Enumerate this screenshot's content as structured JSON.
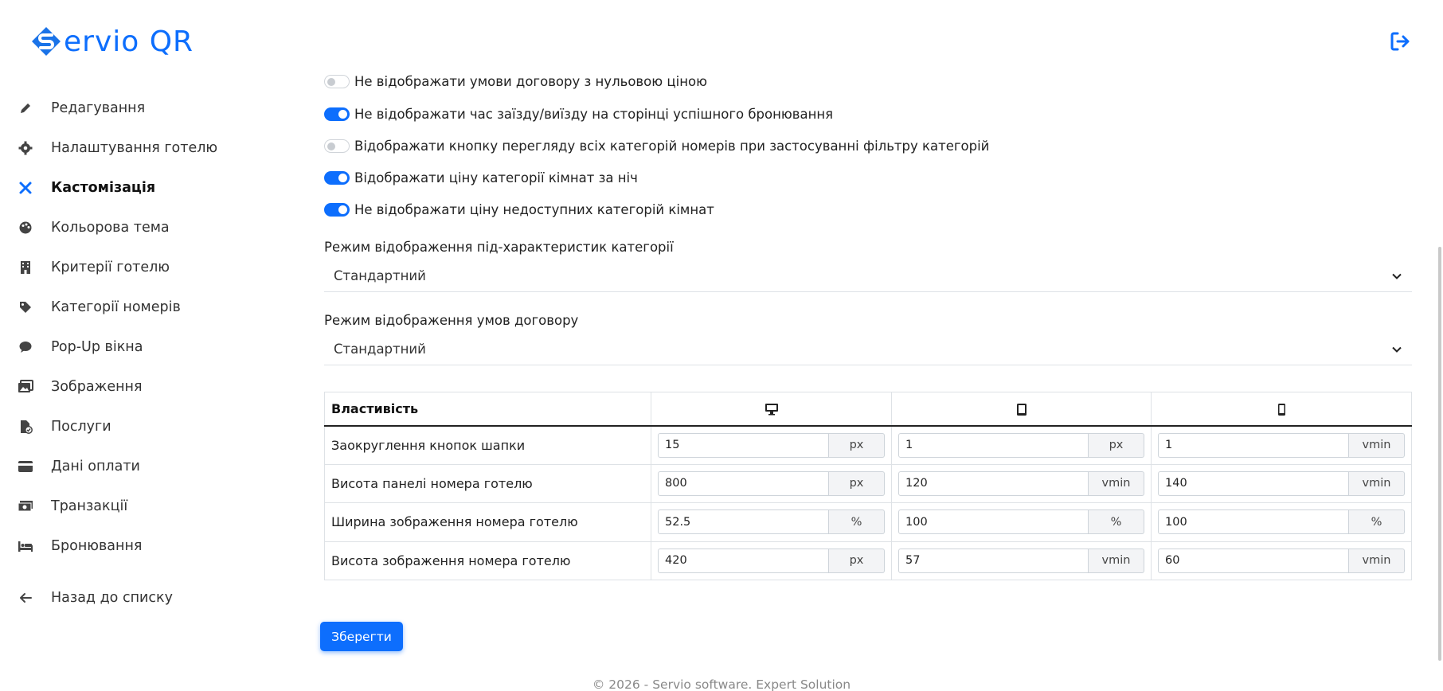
{
  "brand": {
    "logo_text": "ervio QR",
    "logo_icon": "servio-s-logo-icon",
    "accent": "#0d6efd"
  },
  "header": {
    "logout_icon": "logout-icon"
  },
  "sidebar": {
    "items": [
      {
        "label": "Редагування",
        "icon": "pencil-icon"
      },
      {
        "label": "Налаштування готелю",
        "icon": "gear-icon"
      },
      {
        "label": "Кастомізація",
        "icon": "tools-icon",
        "active": true
      },
      {
        "label": "Кольорова тема",
        "icon": "palette-icon"
      },
      {
        "label": "Критерії готелю",
        "icon": "building-icon"
      },
      {
        "label": "Категорії номерів",
        "icon": "tag-icon"
      },
      {
        "label": "Pop-Up вікна",
        "icon": "chat-bubble-icon"
      },
      {
        "label": "Зображення",
        "icon": "images-icon"
      },
      {
        "label": "Послуги",
        "icon": "file-check-icon"
      },
      {
        "label": "Дані оплати",
        "icon": "credit-card-icon"
      },
      {
        "label": "Транзакції",
        "icon": "money-icon"
      },
      {
        "label": "Бронювання",
        "icon": "bed-icon"
      }
    ],
    "back": {
      "label": "Назад до списку",
      "icon": "arrow-left-icon"
    }
  },
  "main": {
    "toggles": [
      {
        "label": "Не відображати умови договору з нульовою ціною",
        "on": false
      },
      {
        "label": "Не відображати час заїзду/виїзду на сторінці успішного бронювання",
        "on": true
      },
      {
        "label": "Відображати кнопку перегляду всіх категорій номерів при застосуванні фільтру категорій",
        "on": false
      },
      {
        "label": "Відображати ціну категорії кімнат за ніч",
        "on": true
      },
      {
        "label": "Не відображати ціну недоступних категорій кімнат",
        "on": true
      }
    ],
    "subfeature_mode": {
      "label": "Режим відображення під-характеристик категорії",
      "value": "Стандартний"
    },
    "contract_mode": {
      "label": "Режим відображення умов договору",
      "value": "Стандартний"
    },
    "table": {
      "header_property": "Властивість",
      "device_icons": [
        "desktop-icon",
        "tablet-icon",
        "phone-icon"
      ],
      "rows": [
        {
          "name": "Заокруглення кнопок шапки",
          "cells": [
            {
              "value": "15",
              "unit": "px"
            },
            {
              "value": "1",
              "unit": "px"
            },
            {
              "value": "1",
              "unit": "vmin"
            }
          ]
        },
        {
          "name": "Висота панелі номера готелю",
          "cells": [
            {
              "value": "800",
              "unit": "px"
            },
            {
              "value": "120",
              "unit": "vmin"
            },
            {
              "value": "140",
              "unit": "vmin"
            }
          ]
        },
        {
          "name": "Ширина зображення номера готелю",
          "cells": [
            {
              "value": "52.5",
              "unit": "%"
            },
            {
              "value": "100",
              "unit": "%"
            },
            {
              "value": "100",
              "unit": "%"
            }
          ]
        },
        {
          "name": "Висота зображення номера готелю",
          "cells": [
            {
              "value": "420",
              "unit": "px"
            },
            {
              "value": "57",
              "unit": "vmin"
            },
            {
              "value": "60",
              "unit": "vmin"
            }
          ]
        }
      ]
    },
    "save_label": "Зберегти"
  },
  "footer": {
    "text": "© 2026 - Servio software. Expert Solution"
  }
}
